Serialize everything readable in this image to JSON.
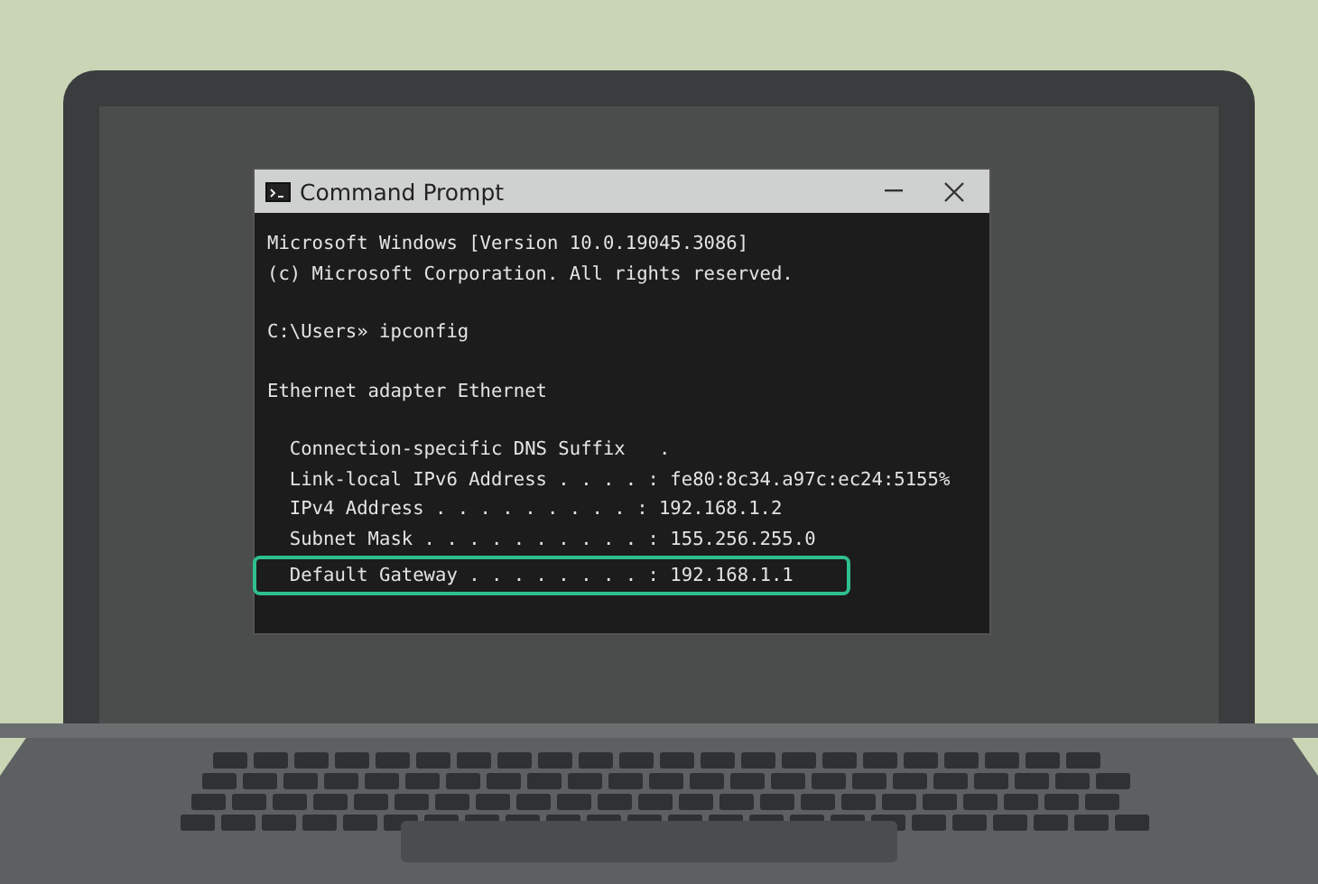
{
  "window": {
    "title": "Command Prompt"
  },
  "console": {
    "blocks": [
      {
        "lines": [
          {
            "text": "Microsoft Windows [Version 10.0.19045.3086]",
            "highlighted": false
          },
          {
            "text": "(c) Microsoft Corporation. All rights reserved.",
            "highlighted": false
          }
        ]
      },
      {
        "lines": [
          {
            "text": "C:\\Users» ipconfig",
            "highlighted": false
          }
        ]
      },
      {
        "lines": [
          {
            "text": "Ethernet adapter Ethernet",
            "highlighted": false
          }
        ]
      },
      {
        "lines": [
          {
            "text": "  Connection-specific DNS Suffix   .",
            "highlighted": false
          },
          {
            "text": "  Link-local IPv6 Address . . . . : fe80:8c34.a97c:ec24:5155%",
            "highlighted": false
          },
          {
            "text": "  IPv4 Address . . . . . . . . . : 192.168.1.2",
            "highlighted": false
          },
          {
            "text": "  Subnet Mask . . . . . . . . . . : 155.256.255.0",
            "highlighted": false
          },
          {
            "text": "  Default Gateway . . . . . . . . : 192.168.1.1",
            "highlighted": true
          }
        ]
      }
    ]
  }
}
